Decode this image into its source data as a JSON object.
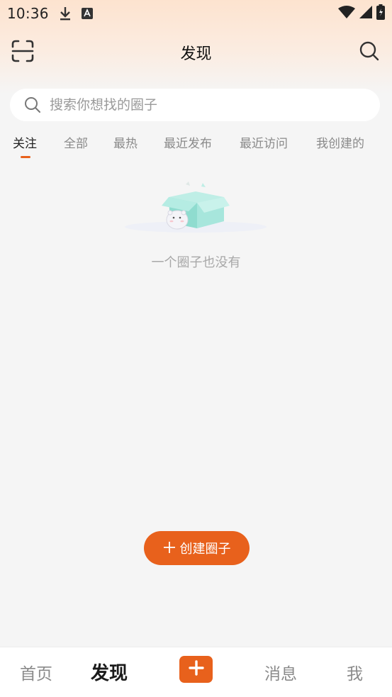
{
  "status_bar": {
    "time": "10:36",
    "icons": [
      "download-icon",
      "keyboard-a-icon",
      "wifi-icon",
      "signal-icon",
      "battery-icon"
    ]
  },
  "header": {
    "title": "发现",
    "left_icon": "scan-icon",
    "right_icon": "search-icon"
  },
  "search": {
    "placeholder": "搜索你想找的圈子",
    "value": ""
  },
  "tabs": [
    {
      "label": "关注",
      "active": true
    },
    {
      "label": "全部",
      "active": false
    },
    {
      "label": "最热",
      "active": false
    },
    {
      "label": "最近发布",
      "active": false
    },
    {
      "label": "最近访问",
      "active": false
    },
    {
      "label": "我创建的",
      "active": false
    }
  ],
  "empty_state": {
    "message": "一个圈子也没有",
    "illustration": "empty-box-illustration"
  },
  "create_button": {
    "label": "创建圈子"
  },
  "bottom_nav": {
    "items": [
      {
        "label": "首页",
        "active": false
      },
      {
        "label": "发现",
        "active": true
      },
      {
        "label": "",
        "icon": "plus-icon"
      },
      {
        "label": "消息",
        "active": false
      },
      {
        "label": "我",
        "active": false
      }
    ]
  },
  "colors": {
    "accent": "#e8611c",
    "background": "#f5f5f5",
    "header_gradient": "#fde3cf",
    "box_teal": "#8fdccf"
  }
}
